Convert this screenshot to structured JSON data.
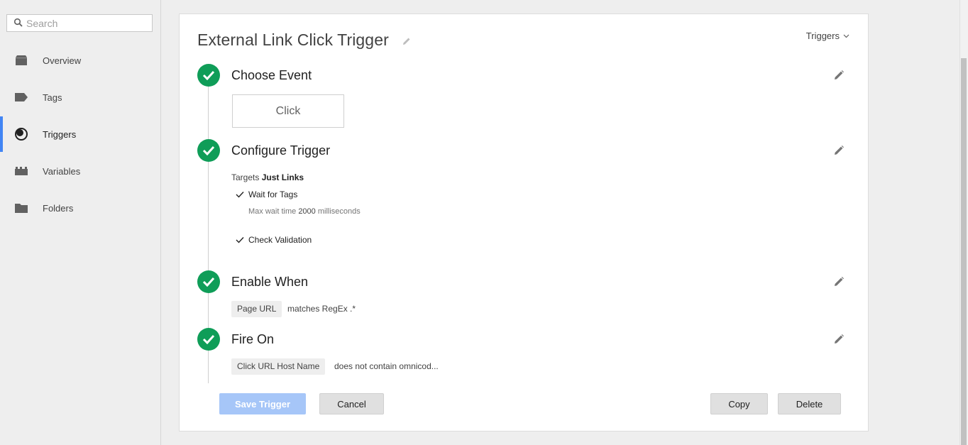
{
  "search": {
    "placeholder": "Search"
  },
  "sidebar": {
    "items": [
      {
        "label": "Overview",
        "icon": "overview-icon"
      },
      {
        "label": "Tags",
        "icon": "tag-icon"
      },
      {
        "label": "Triggers",
        "icon": "trigger-icon",
        "active": true
      },
      {
        "label": "Variables",
        "icon": "variables-icon"
      },
      {
        "label": "Folders",
        "icon": "folder-icon"
      }
    ]
  },
  "trigger": {
    "title": "External Link Click Trigger",
    "breadcrumb_dropdown": "Triggers"
  },
  "steps": {
    "choose_event": {
      "title": "Choose Event",
      "event": "Click"
    },
    "configure": {
      "title": "Configure Trigger",
      "targets_prefix": "Targets",
      "targets_value": "Just Links",
      "wait_for_tags": "Wait for Tags",
      "max_wait_prefix": "Max wait time",
      "max_wait_value": "2000",
      "max_wait_unit": "milliseconds",
      "check_validation": "Check Validation"
    },
    "enable_when": {
      "title": "Enable When",
      "variable": "Page URL",
      "condition": "matches RegEx .*"
    },
    "fire_on": {
      "title": "Fire On",
      "variable": "Click URL Host Name",
      "condition": "does not contain omnicod..."
    }
  },
  "buttons": {
    "save": "Save Trigger",
    "cancel": "Cancel",
    "copy": "Copy",
    "delete": "Delete"
  },
  "colors": {
    "accent": "#4285f4",
    "success": "#0f9d58",
    "save_disabled": "#a6c6f8"
  }
}
